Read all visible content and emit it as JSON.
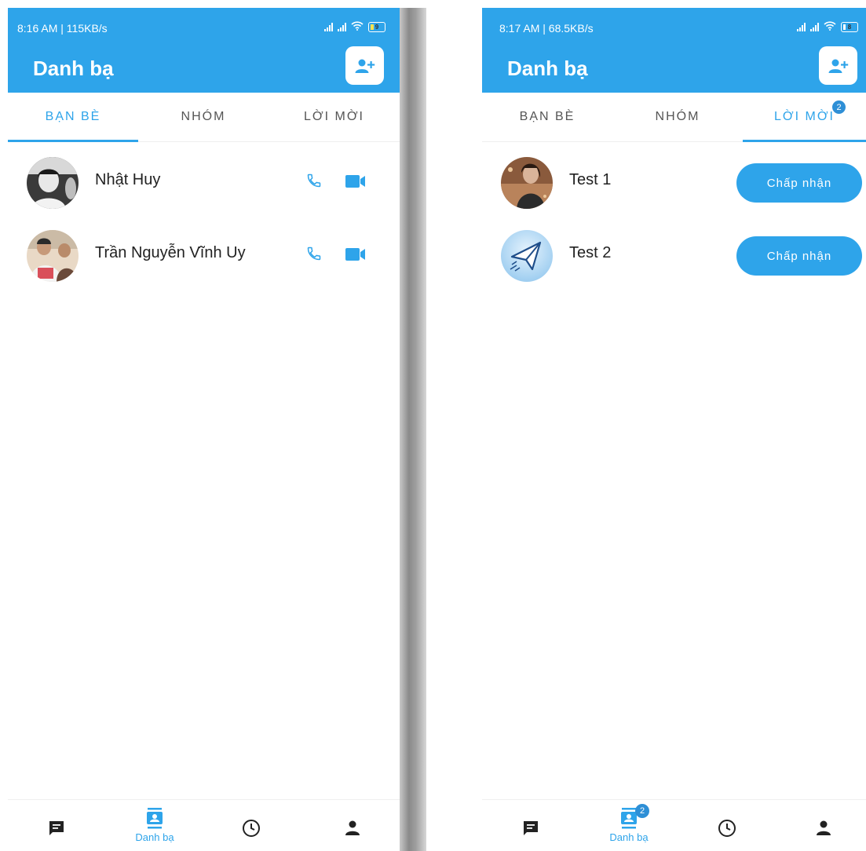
{
  "colors": {
    "primary": "#2ea4ea",
    "header": "#2ea4ea",
    "text": "#222222",
    "tab_inactive": "#555555"
  },
  "screens": [
    {
      "status": {
        "time": "8:16 AM | 115KB/s",
        "battery": "9"
      },
      "header": {
        "title": "Danh bạ",
        "add_icon": "add-person-icon"
      },
      "tabs": [
        {
          "label": "BẠN BÈ"
        },
        {
          "label": "NHÓM"
        },
        {
          "label": "LỜI MỜI"
        }
      ],
      "active_tab": "BẠN BÈ",
      "contacts": [
        {
          "name": "Nhật Huy",
          "actions": [
            "phone-icon",
            "video-call-icon"
          ]
        },
        {
          "name": "Trần Nguyễn Vĩnh Uy",
          "actions": [
            "phone-icon",
            "video-call-icon"
          ]
        }
      ],
      "bottom_nav": {
        "items": [
          "chat-icon",
          "contacts-icon",
          "history-icon",
          "profile-icon"
        ],
        "active_label": "Danh bạ"
      }
    },
    {
      "status": {
        "time": "8:17 AM | 68.5KB/s",
        "battery": "8"
      },
      "header": {
        "title": "Danh bạ",
        "add_icon": "add-person-icon"
      },
      "tabs": [
        {
          "label": "BẠN BÈ"
        },
        {
          "label": "NHÓM"
        },
        {
          "label": "LỜI MỜI",
          "badge": "2"
        }
      ],
      "active_tab": "LỜI MỜI",
      "invitations": [
        {
          "name": "Test 1",
          "button": "Chấp nhận"
        },
        {
          "name": "Test 2",
          "button": "Chấp nhận"
        }
      ],
      "bottom_nav": {
        "items": [
          "chat-icon",
          "contacts-icon",
          "history-icon",
          "profile-icon"
        ],
        "active_label": "Danh bạ",
        "contacts_badge": "2"
      }
    }
  ]
}
